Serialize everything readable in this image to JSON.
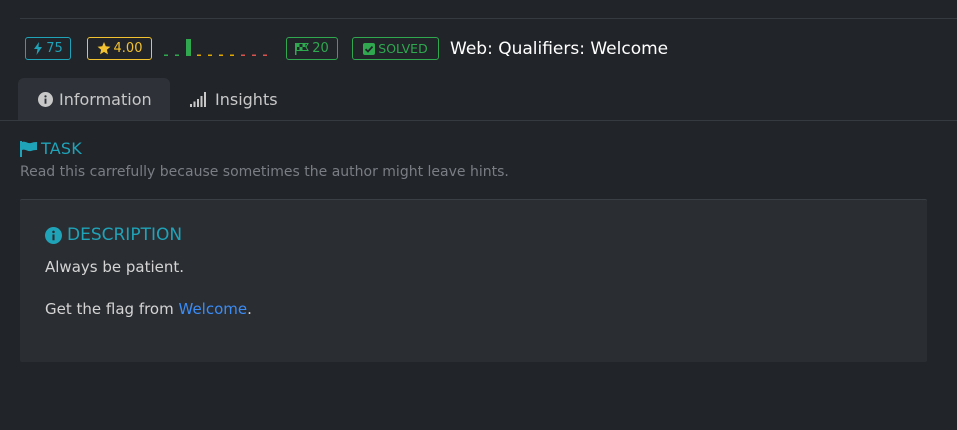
{
  "header": {
    "points": "75",
    "rating": "4.00",
    "solves": "20",
    "status": "SOLVED",
    "title": "Web: Qualifiers: Welcome",
    "rating_distribution": [
      0.08,
      0.08,
      1.0,
      0.06,
      0.06,
      0.06,
      0.06,
      0.06,
      0.06,
      0.06
    ],
    "rating_distribution_colors": [
      "#2fa84f",
      "#2fa84f",
      "#2fa84f",
      "#e0a800",
      "#e0a800",
      "#e0a800",
      "#e0a800",
      "#d9534f",
      "#d9534f",
      "#d9534f"
    ]
  },
  "tabs": [
    {
      "label": "Information",
      "icon": "info-circle-icon",
      "active": true
    },
    {
      "label": "Insights",
      "icon": "bar-signal-icon",
      "active": false
    }
  ],
  "task": {
    "heading": "TASK",
    "subtitle": "Read this carrefully because sometimes the author might leave hints."
  },
  "description": {
    "heading": "DESCRIPTION",
    "line1": "Always be patient.",
    "line2_prefix": "Get the flag from ",
    "link_text": "Welcome",
    "line2_suffix": "."
  },
  "colors": {
    "accent_teal": "#1fa3b8",
    "rating_yellow": "#f2c230",
    "success_green": "#2fa84f",
    "link_blue": "#3b8cf5",
    "background": "#212429",
    "panel": "#2a2d32"
  }
}
